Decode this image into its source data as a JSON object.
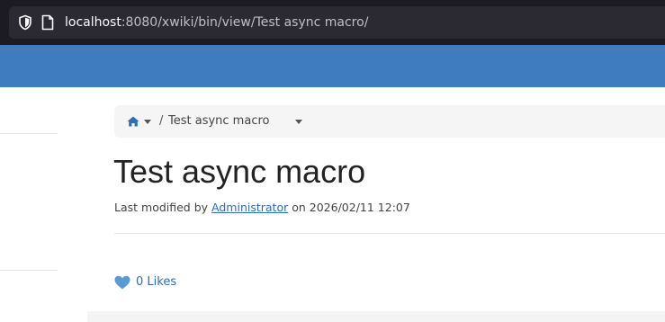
{
  "browser": {
    "url_host": "localhost",
    "url_path": ":8080/xwiki/bin/view/Test async macro/"
  },
  "breadcrumb": {
    "separator": "/",
    "current": "Test async macro"
  },
  "page": {
    "title": "Test async macro",
    "modified_prefix": "Last modified by ",
    "author": "Administrator",
    "modified_middle": " on ",
    "date": "2026/02/11 12:07"
  },
  "likes": {
    "label": "0 Likes"
  },
  "colors": {
    "top_bar": "#3e7cbf",
    "link": "#2c6fb3",
    "heart": "#5b9bd5"
  },
  "icons": [
    "shield-icon",
    "page-icon",
    "home-icon",
    "caret-down-icon",
    "heart-icon"
  ]
}
